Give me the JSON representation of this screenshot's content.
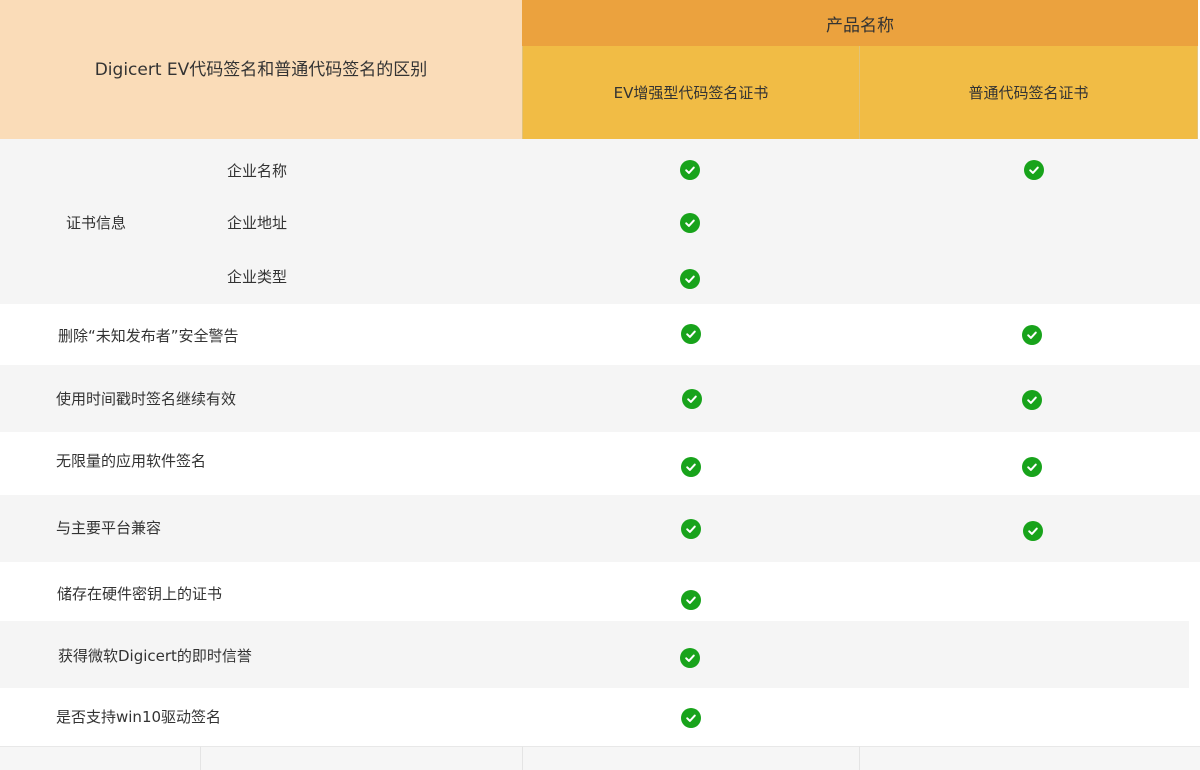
{
  "header": {
    "title": "Digicert EV代码签名和普通代码签名的区别",
    "product_header": "产品名称",
    "columns": [
      "EV增强型代码签名证书",
      "普通代码签名证书"
    ]
  },
  "group": {
    "label": "证书信息",
    "items": [
      "企业名称",
      "企业地址",
      "企业类型"
    ]
  },
  "features": [
    "删除“未知发布者”安全警告",
    "使用时间戳时签名继续有效",
    "无限量的应用软件签名",
    "与主要平台兼容",
    "储存在硬件密钥上的证书",
    "获得微软Digicert的即时信誉",
    "是否支持win10驱动签名"
  ],
  "support": {
    "company_name": {
      "ev": true,
      "standard": true
    },
    "company_address": {
      "ev": true,
      "standard": false
    },
    "company_type": {
      "ev": true,
      "standard": false
    },
    "remove_warning": {
      "ev": true,
      "standard": true
    },
    "timestamp_valid": {
      "ev": true,
      "standard": true
    },
    "unlimited_signing": {
      "ev": true,
      "standard": true
    },
    "platform_compat": {
      "ev": true,
      "standard": true
    },
    "hardware_key": {
      "ev": true,
      "standard": false
    },
    "instant_reputation": {
      "ev": true,
      "standard": false
    },
    "win10_driver": {
      "ev": true,
      "standard": false
    }
  },
  "colors": {
    "header_title_bg": "#fadcb8",
    "product_header_bg": "#eba23e",
    "column_header_bg": "#f1bc45",
    "row_grey_bg": "#f5f5f5",
    "check_color": "#18a31b"
  },
  "icons": {
    "check": "check-circle-icon"
  }
}
